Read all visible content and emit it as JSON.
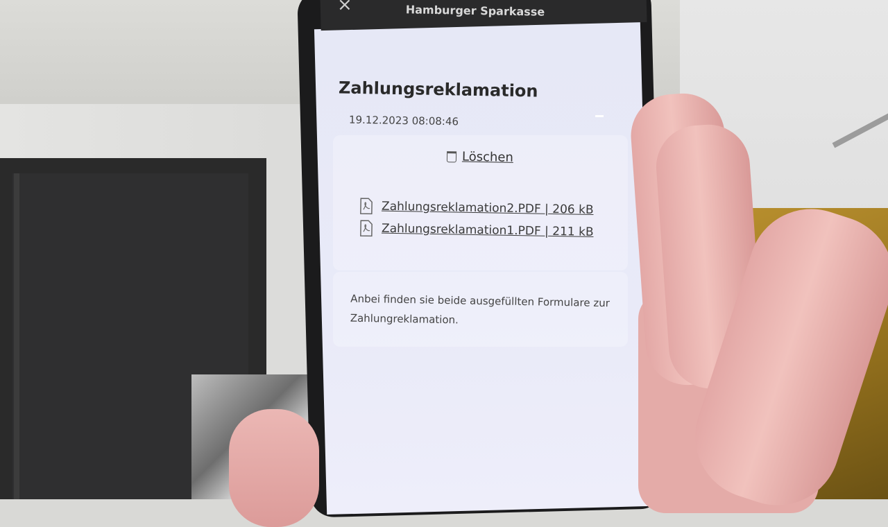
{
  "app": {
    "title": "Hamburger Sparkasse",
    "close_icon": "close-icon"
  },
  "message": {
    "title": "Zahlungsreklamation",
    "date": "19.12.2023 08:08:46",
    "delete_label": "Löschen",
    "attachments": [
      {
        "label": "Zahlungsreklamation2.PDF | 206 kB",
        "icon": "pdf-icon"
      },
      {
        "label": "Zahlungsreklamation1.PDF | 211 kB",
        "icon": "pdf-icon"
      }
    ],
    "body": "Anbei finden sie beide ausgefüllten Formulare zur Zahlungreklamation."
  }
}
